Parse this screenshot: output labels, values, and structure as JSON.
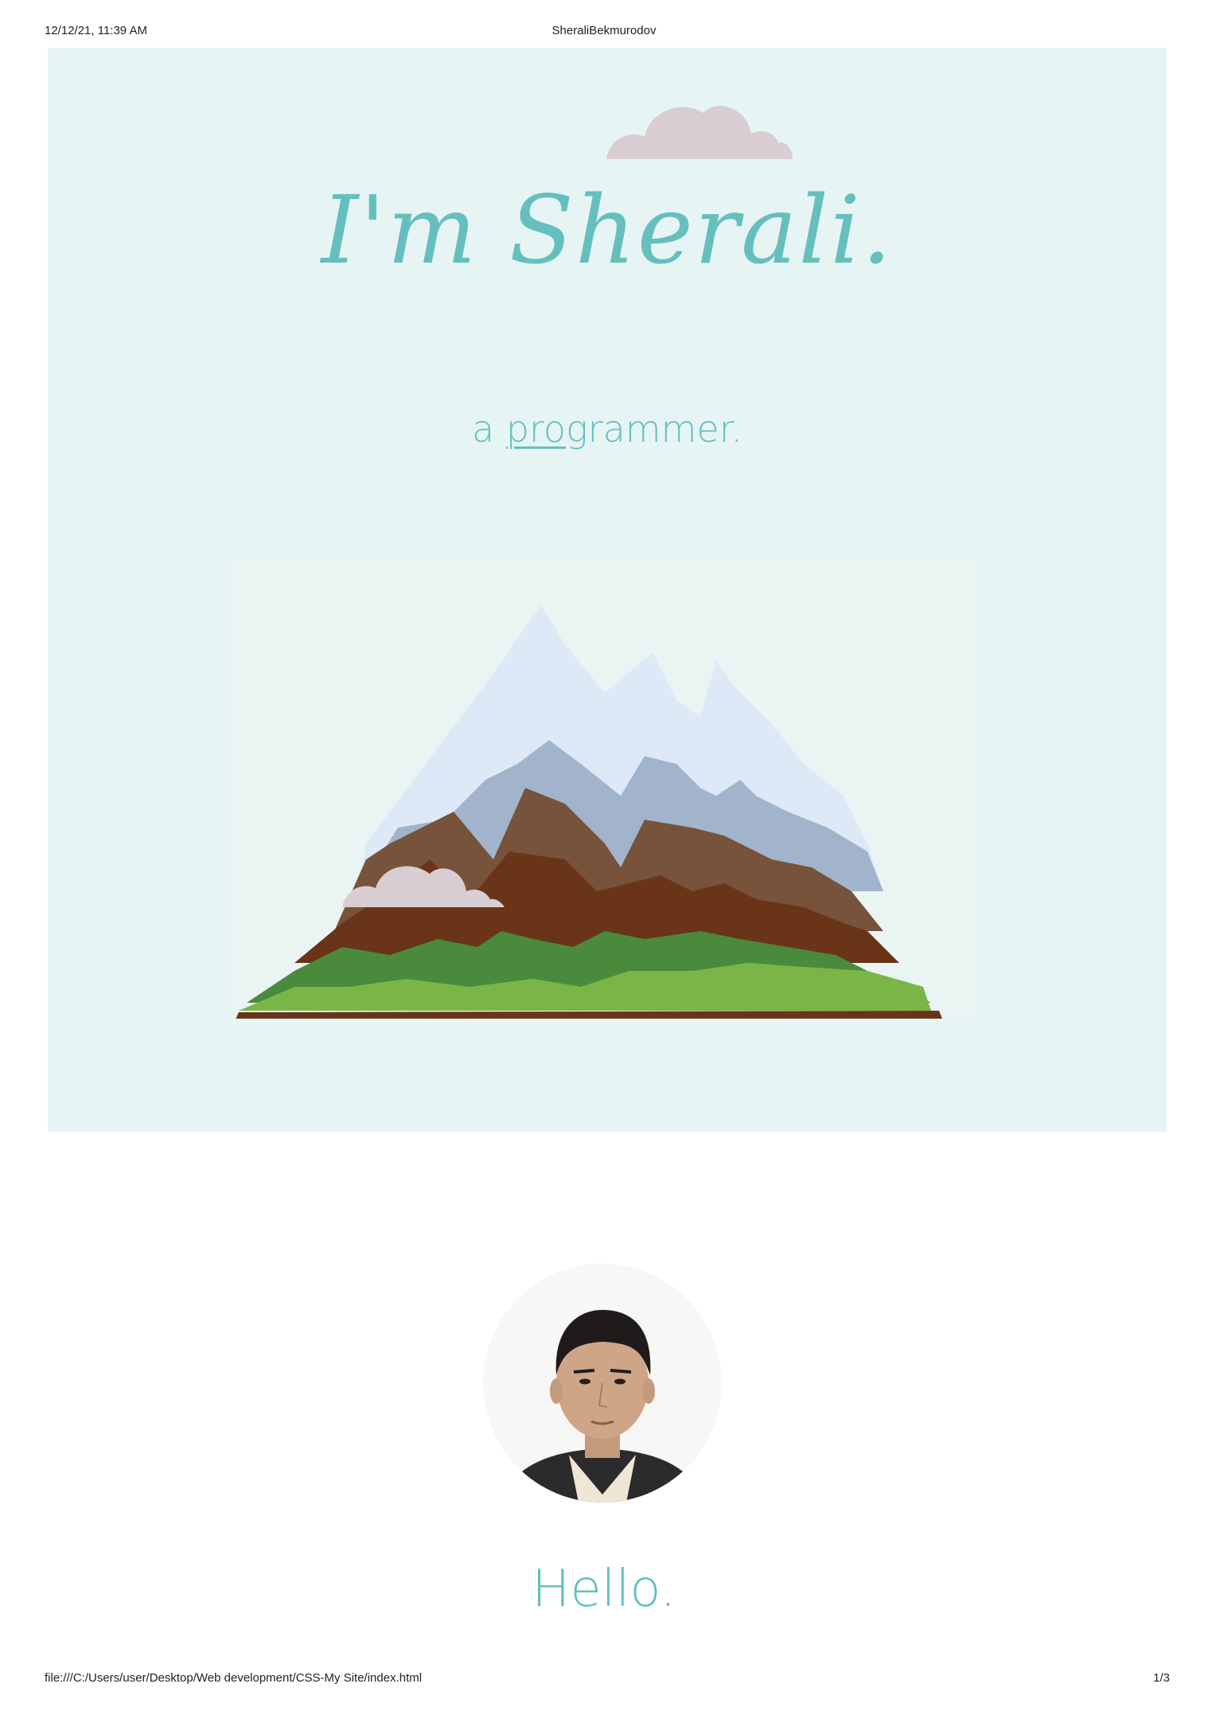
{
  "print_header": {
    "datetime": "12/12/21, 11:39 AM",
    "page_title": "SheraliBekmurodov"
  },
  "hero": {
    "title": "I'm Sherali.",
    "subtitle_prefix": "a ",
    "subtitle_underlined": "pro",
    "subtitle_suffix": "grammer."
  },
  "profile": {
    "heading": "Hello."
  },
  "print_footer": {
    "url": "file:///C:/Users/user/Desktop/Web development/CSS-My Site/index.html",
    "page_number": "1/3"
  },
  "colors": {
    "accent": "#66bfbf",
    "hero_background": "#e6f5f4",
    "cloud": "#d8cdd2"
  },
  "icons": {
    "cloud": "cloud-icon",
    "mountain": "mountain-illustration"
  }
}
